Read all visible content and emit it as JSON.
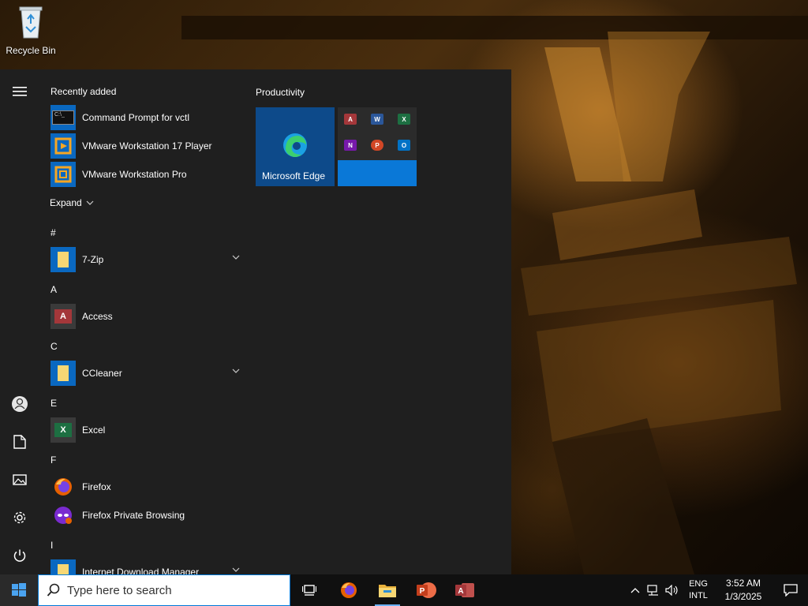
{
  "desktop": {
    "icons": [
      {
        "label": "Recycle Bin",
        "icon": "recycle-bin-icon"
      }
    ]
  },
  "start_menu": {
    "rail": {
      "items": [
        {
          "name": "menu",
          "icon": "hamburger-icon"
        },
        {
          "name": "account",
          "icon": "user-icon"
        },
        {
          "name": "documents",
          "icon": "document-icon"
        },
        {
          "name": "pictures",
          "icon": "image-icon"
        },
        {
          "name": "settings",
          "icon": "gear-icon"
        },
        {
          "name": "power",
          "icon": "power-icon"
        }
      ]
    },
    "recently_added": {
      "heading": "Recently added",
      "items": [
        {
          "label": "Command Prompt for vctl",
          "icon": "command-prompt-icon"
        },
        {
          "label": "VMware Workstation 17 Player",
          "icon": "vmware-player-icon"
        },
        {
          "label": "VMware Workstation Pro",
          "icon": "vmware-pro-icon"
        }
      ],
      "expand_label": "Expand"
    },
    "groups": [
      {
        "letter": "#",
        "apps": [
          {
            "label": "7-Zip",
            "icon": "folder-icon",
            "expandable": true
          }
        ]
      },
      {
        "letter": "A",
        "apps": [
          {
            "label": "Access",
            "icon": "access-icon",
            "expandable": false
          }
        ]
      },
      {
        "letter": "C",
        "apps": [
          {
            "label": "CCleaner",
            "icon": "folder-icon",
            "expandable": true
          }
        ]
      },
      {
        "letter": "E",
        "apps": [
          {
            "label": "Excel",
            "icon": "excel-icon",
            "expandable": false
          }
        ]
      },
      {
        "letter": "F",
        "apps": [
          {
            "label": "Firefox",
            "icon": "firefox-icon",
            "expandable": false
          },
          {
            "label": "Firefox Private Browsing",
            "icon": "firefox-private-icon",
            "expandable": false
          }
        ]
      },
      {
        "letter": "I",
        "apps": [
          {
            "label": "Internet Download Manager",
            "icon": "folder-icon",
            "expandable": true
          }
        ]
      }
    ],
    "tiles": {
      "group_title": "Productivity",
      "edge_label": "Microsoft Edge",
      "office_apps": [
        "A",
        "W",
        "X",
        "N",
        "P",
        "O"
      ]
    }
  },
  "taskbar": {
    "search_placeholder": "Type here to search",
    "pinned": [
      {
        "name": "task-view",
        "icon": "task-view-icon"
      },
      {
        "name": "firefox",
        "icon": "firefox-icon"
      },
      {
        "name": "file-explorer",
        "icon": "folder-icon",
        "active": true
      },
      {
        "name": "powerpoint",
        "icon": "powerpoint-icon"
      },
      {
        "name": "access",
        "icon": "access-icon"
      }
    ],
    "tray": {
      "language_line1": "ENG",
      "language_line2": "INTL",
      "time": "3:52 AM",
      "date": "1/3/2025"
    }
  },
  "colors": {
    "start_bg": "#1f1f1f",
    "taskbar_bg": "#101010",
    "accent": "#0078d7",
    "edge_tile": "#0d4a8a"
  }
}
